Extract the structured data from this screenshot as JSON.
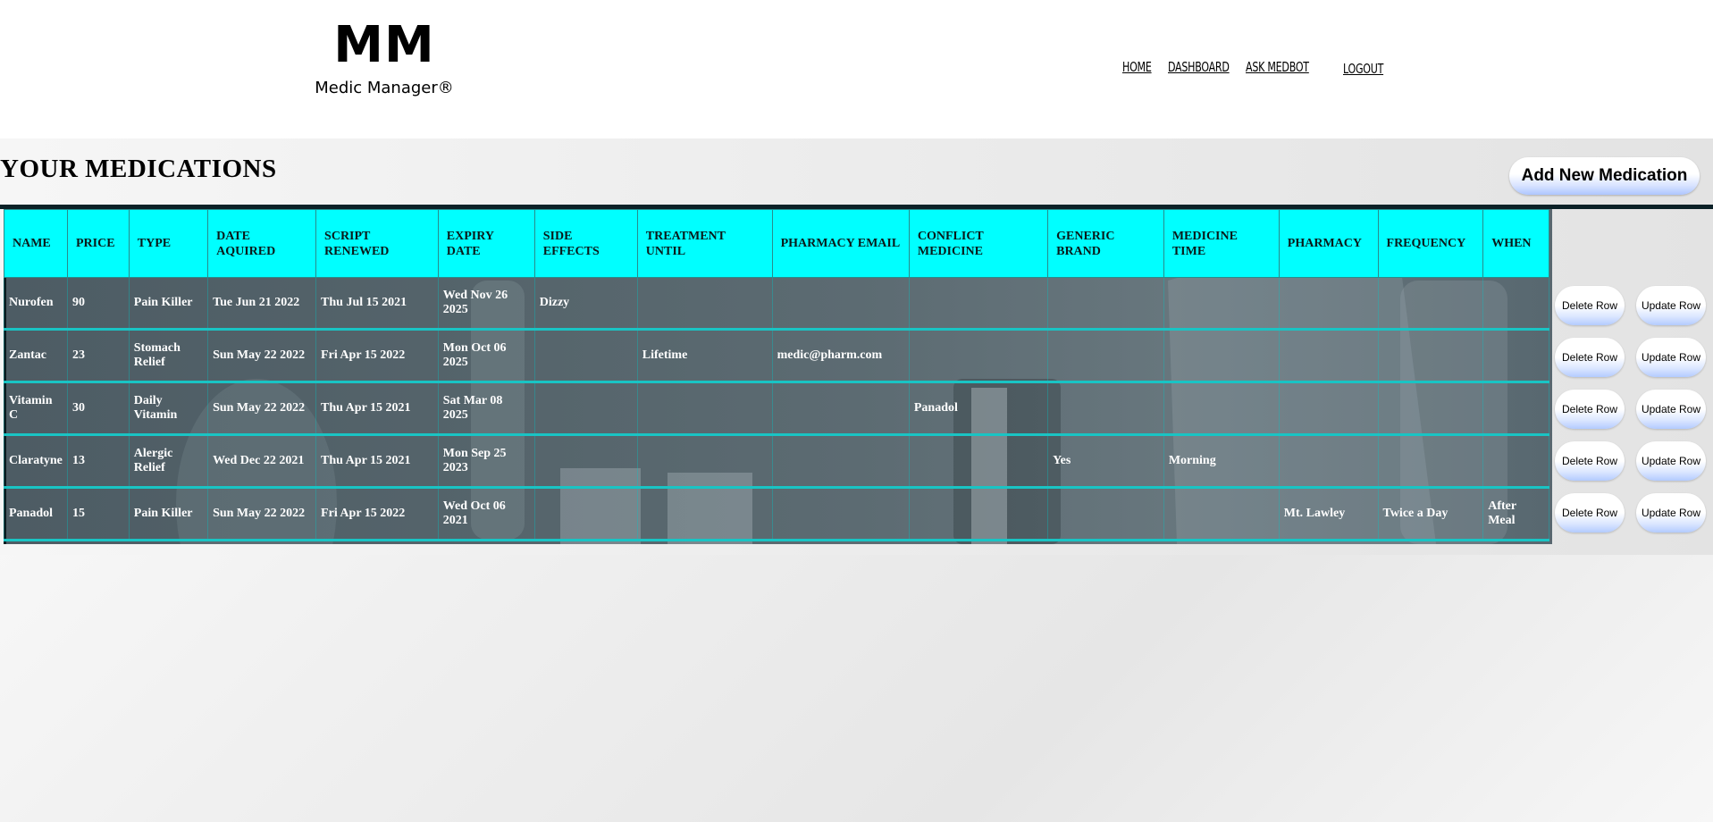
{
  "brand": {
    "mark": "MM",
    "name": "Medic Manager®"
  },
  "nav": {
    "home": "HOME",
    "dashboard": "DASHBOARD",
    "ask_medbot": "ASK MEDBOT",
    "logout": "LOGOUT"
  },
  "page": {
    "title": "YOUR MEDICATIONS",
    "add_button": "Add New Medication"
  },
  "table": {
    "headers": [
      "NAME",
      "PRICE",
      "TYPE",
      "DATE AQUIRED",
      "SCRIPT RENEWED",
      "EXPIRY DATE",
      "SIDE EFFECTS",
      "TREATMENT UNTIL",
      "PHARMACY EMAIL",
      "CONFLICT MEDICINE",
      "GENERIC BRAND",
      "MEDICINE TIME",
      "PHARMACY",
      "FREQUENCY",
      "WHEN"
    ],
    "rows": [
      [
        "Nurofen",
        "90",
        "Pain Killer",
        "Tue Jun 21 2022",
        "Thu Jul 15 2021",
        "Wed Nov 26 2025",
        "Dizzy",
        "",
        "",
        "",
        "",
        "",
        "",
        "",
        ""
      ],
      [
        "Zantac",
        "23",
        "Stomach Relief",
        "Sun May 22 2022",
        "Fri Apr 15 2022",
        "Mon Oct 06 2025",
        "",
        "Lifetime",
        "medic@pharm.com",
        "",
        "",
        "",
        "",
        "",
        ""
      ],
      [
        "Vitamin C",
        "30",
        "Daily Vitamin",
        "Sun May 22 2022",
        "Thu Apr 15 2021",
        "Sat Mar 08 2025",
        "",
        "",
        "",
        "Panadol",
        "",
        "",
        "",
        "",
        ""
      ],
      [
        "Claratyne",
        "13",
        "Alergic Relief",
        "Wed Dec 22 2021",
        "Thu Apr 15 2021",
        "Mon Sep 25 2023",
        "",
        "",
        "",
        "",
        "Yes",
        "Morning",
        "",
        "",
        ""
      ],
      [
        "Panadol",
        "15",
        "Pain Killer",
        "Sun May 22 2022",
        "Fri Apr 15 2022",
        "Wed Oct 06 2021",
        "",
        "",
        "",
        "",
        "",
        "",
        "Mt. Lawley",
        "Twice a Day",
        "After Meal"
      ]
    ],
    "delete_label": "Delete Row",
    "update_label": "Update Row"
  },
  "colors": {
    "header_bg": "#00ffff",
    "row_border": "#19c4c4",
    "button_gradient_end": "#aec6ff"
  }
}
